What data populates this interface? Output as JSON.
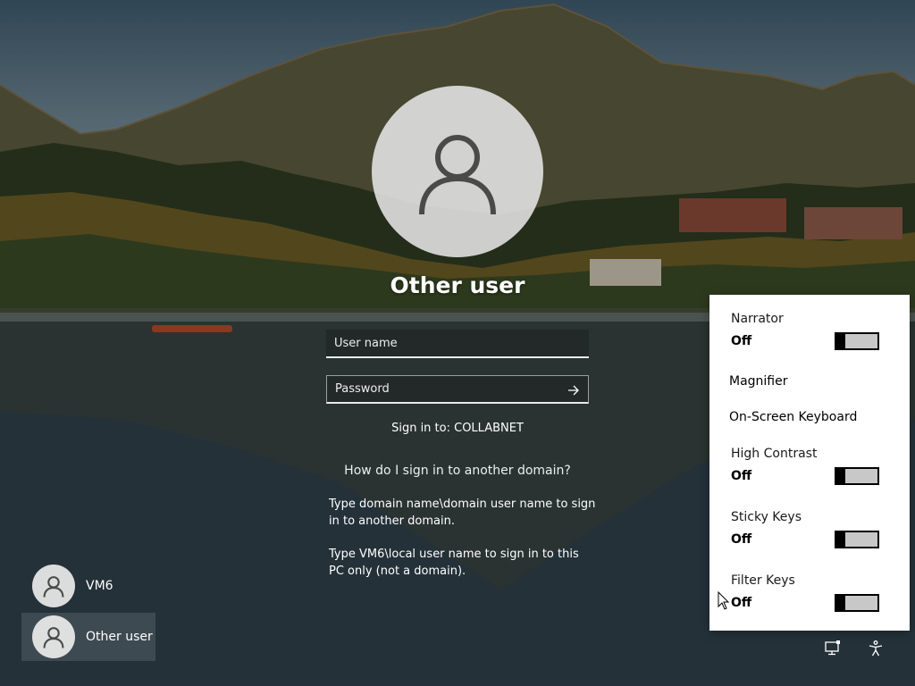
{
  "signin": {
    "title": "Other user",
    "username_placeholder": "User name",
    "password_placeholder": "Password",
    "signin_to": "Sign in to: COLLABNET",
    "help_link": "How do I sign in to another domain?",
    "help_text_1": "Type domain name\\domain user name to sign in to another domain.",
    "help_text_2": "Type VM6\\local user name to sign in to this PC only (not a domain)."
  },
  "users": [
    {
      "name": "VM6",
      "icon": "user-icon"
    },
    {
      "name": "Other user",
      "icon": "user-icon",
      "selected": true
    }
  ],
  "accessibility": {
    "narrator": {
      "label": "Narrator",
      "state": "Off"
    },
    "magnifier": {
      "label": "Magnifier"
    },
    "onscreen_keyboard": {
      "label": "On-Screen Keyboard"
    },
    "high_contrast": {
      "label": "High Contrast",
      "state": "Off"
    },
    "sticky_keys": {
      "label": "Sticky Keys",
      "state": "Off"
    },
    "filter_keys": {
      "label": "Filter Keys",
      "state": "Off"
    }
  },
  "tray": {
    "network_icon": "network-icon",
    "accessibility_icon": "accessibility-icon"
  },
  "colors": {
    "flyout_bg": "#ffffff",
    "toggle_off_track": "#c8c8c8",
    "toggle_knob": "#000000"
  }
}
